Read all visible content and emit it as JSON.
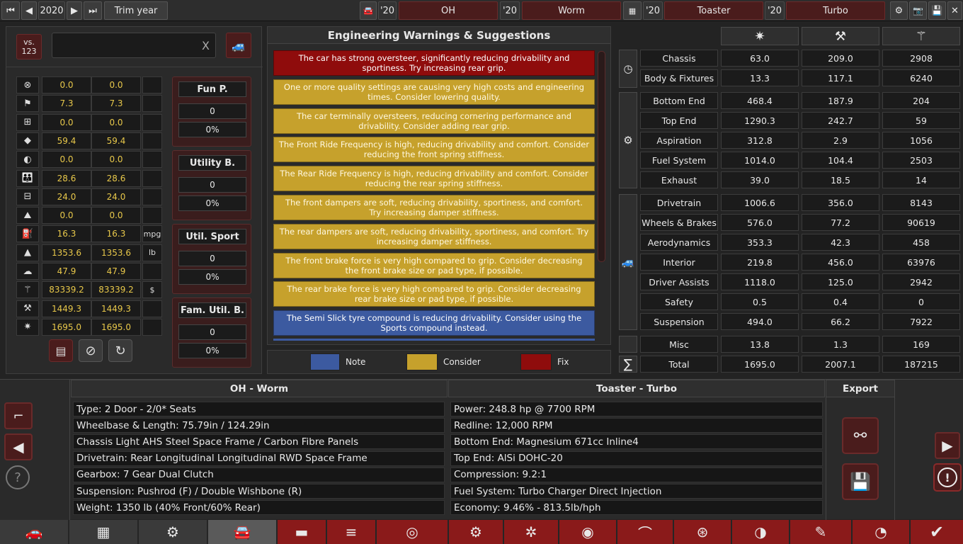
{
  "topbar": {
    "year": "2020",
    "trim_year": "Trim year",
    "model_year_1": "'20",
    "model_1": "OH",
    "trim_year_1": "'20",
    "trim_1": "Worm",
    "engine_year_1": "'20",
    "engine_1": "Toaster",
    "variant_year_1": "'20",
    "variant_1": "Turbo"
  },
  "left": {
    "vs_label": "vs.\n123",
    "search_placeholder": "",
    "clear": "X",
    "stats": [
      {
        "icon": "steering-wheel-icon",
        "a": "0.0",
        "b": "0.0",
        "unit": ""
      },
      {
        "icon": "checkered-flag-icon",
        "a": "7.3",
        "b": "7.3",
        "unit": ""
      },
      {
        "icon": "seat-icon",
        "a": "0.0",
        "b": "0.0",
        "unit": ""
      },
      {
        "icon": "diamond-icon",
        "a": "59.4",
        "b": "59.4",
        "unit": ""
      },
      {
        "icon": "safety-icon",
        "a": "0.0",
        "b": "0.0",
        "unit": ""
      },
      {
        "icon": "family-icon",
        "a": "28.6",
        "b": "28.6",
        "unit": ""
      },
      {
        "icon": "cargo-car-icon",
        "a": "24.0",
        "b": "24.0",
        "unit": ""
      },
      {
        "icon": "offroad-icon",
        "a": "0.0",
        "b": "0.0",
        "unit": ""
      },
      {
        "icon": "fuel-icon",
        "a": "16.3",
        "b": "16.3",
        "unit": "mpg"
      },
      {
        "icon": "weight-icon",
        "a": "1353.6",
        "b": "1353.6",
        "unit": "lb"
      },
      {
        "icon": "emissions-icon",
        "a": "47.9",
        "b": "47.9",
        "unit": ""
      },
      {
        "icon": "cost-icon",
        "a": "83339.2",
        "b": "83339.2",
        "unit": "$"
      },
      {
        "icon": "manufacturing-icon",
        "a": "1449.3",
        "b": "1449.3",
        "unit": ""
      },
      {
        "icon": "engineering-icon",
        "a": "1695.0",
        "b": "1695.0",
        "unit": ""
      }
    ],
    "scores": [
      {
        "title": "Fun P.",
        "value": "0",
        "pct": "0%"
      },
      {
        "title": "Utility B.",
        "value": "0",
        "pct": "0%"
      },
      {
        "title": "Util. Sport",
        "value": "0",
        "pct": "0%"
      },
      {
        "title": "Fam. Util. B.",
        "value": "0",
        "pct": "0%"
      }
    ]
  },
  "warnings": {
    "title": "Engineering Warnings & Suggestions",
    "items": [
      {
        "kind": "fix",
        "text": "The car has strong oversteer, significantly reducing drivability and sportiness. Try increasing rear grip."
      },
      {
        "kind": "consider",
        "text": "One or more quality settings are causing very high costs and engineering times. Consider lowering quality."
      },
      {
        "kind": "consider",
        "text": "The car terminally oversteers, reducing cornering performance and drivability. Consider adding rear grip."
      },
      {
        "kind": "consider",
        "text": "The Front Ride Frequency is high, reducing drivability and comfort. Consider reducing the front spring stiffness."
      },
      {
        "kind": "consider",
        "text": "The Rear Ride Frequency is high, reducing drivability and comfort. Consider reducing the rear spring stiffness."
      },
      {
        "kind": "consider",
        "text": "The front dampers are soft, reducing drivability, sportiness, and comfort. Try increasing damper stiffness."
      },
      {
        "kind": "consider",
        "text": "The rear dampers are soft, reducing drivability, sportiness, and comfort. Try increasing damper stiffness."
      },
      {
        "kind": "consider",
        "text": "The front brake force is very high compared to grip. Consider decreasing the front brake size or pad type, if possible."
      },
      {
        "kind": "consider",
        "text": "The rear brake force is very high compared to grip. Consider decreasing rear brake size or pad type, if possible."
      },
      {
        "kind": "note",
        "text": "The Semi Slick tyre compound is reducing drivability. Consider using the Sports compound instead."
      }
    ],
    "legend": {
      "note": "Note",
      "consider": "Consider",
      "fix": "Fix"
    },
    "colors": {
      "fix": "#8f0c0c",
      "consider": "#c6a12c",
      "note": "#3c5aa0"
    }
  },
  "table": {
    "headers": [
      "engineering-icon",
      "manufacturing-icon",
      "cost-icon"
    ],
    "rows": [
      {
        "name": "Chassis",
        "a": "63.0",
        "b": "209.0",
        "c": "2908"
      },
      {
        "name": "Body & Fixtures",
        "a": "13.3",
        "b": "117.1",
        "c": "6240"
      },
      {
        "name": "Bottom End",
        "a": "468.4",
        "b": "187.9",
        "c": "204"
      },
      {
        "name": "Top End",
        "a": "1290.3",
        "b": "242.7",
        "c": "59"
      },
      {
        "name": "Aspiration",
        "a": "312.8",
        "b": "2.9",
        "c": "1056"
      },
      {
        "name": "Fuel System",
        "a": "1014.0",
        "b": "104.4",
        "c": "2503"
      },
      {
        "name": "Exhaust",
        "a": "39.0",
        "b": "18.5",
        "c": "14"
      },
      {
        "name": "Drivetrain",
        "a": "1006.6",
        "b": "356.0",
        "c": "8143"
      },
      {
        "name": "Wheels & Brakes",
        "a": "576.0",
        "b": "77.2",
        "c": "90619"
      },
      {
        "name": "Aerodynamics",
        "a": "353.3",
        "b": "42.3",
        "c": "458"
      },
      {
        "name": "Interior",
        "a": "219.8",
        "b": "456.0",
        "c": "63976"
      },
      {
        "name": "Driver Assists",
        "a": "1118.0",
        "b": "125.0",
        "c": "2942"
      },
      {
        "name": "Safety",
        "a": "0.5",
        "b": "0.4",
        "c": "0"
      },
      {
        "name": "Suspension",
        "a": "494.0",
        "b": "66.2",
        "c": "7922"
      },
      {
        "name": "Misc",
        "a": "13.8",
        "b": "1.3",
        "c": "169"
      },
      {
        "name": "Total",
        "a": "1695.0",
        "b": "2007.1",
        "c": "187215"
      }
    ],
    "sigma": "∑"
  },
  "bottom": {
    "car_title": "OH - Worm",
    "engine_title": "Toaster - Turbo",
    "export_title": "Export",
    "car_lines": [
      "Type: 2 Door - 2/0* Seats",
      "Wheelbase & Length: 75.79in / 124.29in",
      "Chassis Light AHS Steel Space Frame / Carbon Fibre Panels",
      "Drivetrain: Rear Longitudinal Longitudinal RWD Space Frame",
      "Gearbox: 7 Gear Dual Clutch",
      "Suspension: Pushrod (F) / Double Wishbone (R)",
      "Weight: 1350 lb (40% Front/60% Rear)"
    ],
    "engine_lines": [
      "Power: 248.8 hp @ 7700 RPM",
      "Redline:  12,000 RPM",
      "Bottom End: Magnesium 671cc Inline4",
      "Top End: AlSi DOHC-20",
      "Compression: 9.2:1",
      "Fuel System: Turbo Charger Direct Injection",
      "Economy: 9.46% - 813.5lb/hph"
    ],
    "help": "?",
    "alert": "!"
  }
}
